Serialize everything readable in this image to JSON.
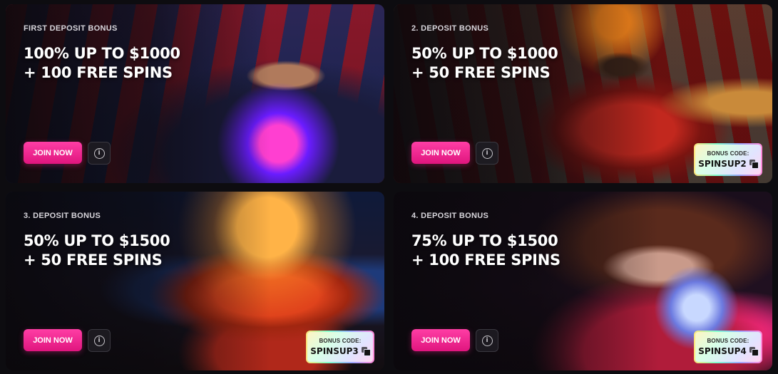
{
  "cards": [
    {
      "label": "FIRST DEPOSIT BONUS",
      "line1": "100% UP TO $1000",
      "line2": "+ 100 FREE SPINS",
      "join_label": "JOIN NOW",
      "info_glyph": "i"
    },
    {
      "label": "2. DEPOSIT BONUS",
      "line1": "50% UP TO $1000",
      "line2": "+ 50 FREE SPINS",
      "join_label": "JOIN NOW",
      "info_glyph": "i",
      "code_label": "BONUS CODE:",
      "code_value": "SPINSUP2"
    },
    {
      "label": "3. DEPOSIT BONUS",
      "line1": "50% UP TO $1500",
      "line2": "+ 50 FREE SPINS",
      "join_label": "JOIN NOW",
      "info_glyph": "i",
      "code_label": "BONUS CODE:",
      "code_value": "SPINSUP3"
    },
    {
      "label": "4. DEPOSIT BONUS",
      "line1": "75% UP TO $1500",
      "line2": "+ 100 FREE SPINS",
      "join_label": "JOIN NOW",
      "info_glyph": "i",
      "code_label": "BONUS CODE:",
      "code_value": "SPINSUP4"
    }
  ],
  "colors": {
    "accent": "#e0157e",
    "background": "#0d0c10"
  },
  "icons": {
    "info": "info-icon",
    "copy": "copy-icon"
  }
}
